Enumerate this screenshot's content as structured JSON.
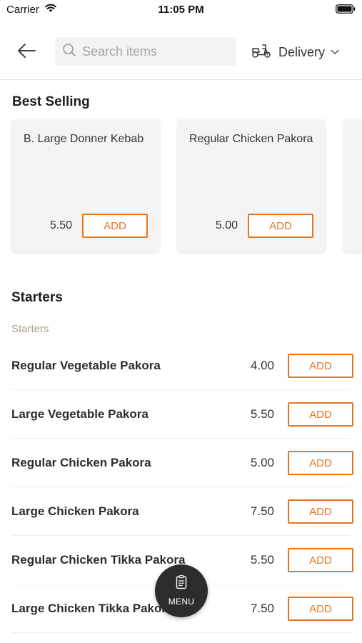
{
  "status_bar": {
    "carrier": "Carrier",
    "time": "11:05 PM"
  },
  "header": {
    "search_placeholder": "Search items",
    "delivery_label": "Delivery"
  },
  "best_selling": {
    "title": "Best Selling",
    "cards": [
      {
        "name": "B. Large Donner Kebab",
        "price": "5.50",
        "add_label": "ADD"
      },
      {
        "name": "Regular Chicken Pakora",
        "price": "5.00",
        "add_label": "ADD"
      }
    ]
  },
  "starters": {
    "title": "Starters",
    "subtitle": "Starters",
    "items": [
      {
        "name": "Regular Vegetable Pakora",
        "price": "4.00",
        "add_label": "ADD"
      },
      {
        "name": "Large Vegetable Pakora",
        "price": "5.50",
        "add_label": "ADD"
      },
      {
        "name": "Regular Chicken Pakora",
        "price": "5.00",
        "add_label": "ADD"
      },
      {
        "name": "Large Chicken Pakora",
        "price": "7.50",
        "add_label": "ADD"
      },
      {
        "name": "Regular Chicken Tikka Pakora",
        "price": "5.50",
        "add_label": "ADD"
      },
      {
        "name": "Large Chicken Tikka Pakora",
        "price": "7.50",
        "add_label": "ADD"
      }
    ]
  },
  "menu_button": {
    "label": "MENU"
  },
  "colors": {
    "accent": "#e8741e",
    "subtitle": "#a89e7f",
    "fab": "#2c2c2c"
  },
  "icons": [
    "wifi-icon",
    "battery-icon",
    "back-arrow-icon",
    "search-icon",
    "scooter-icon",
    "chevron-down-icon",
    "menu-list-icon"
  ]
}
